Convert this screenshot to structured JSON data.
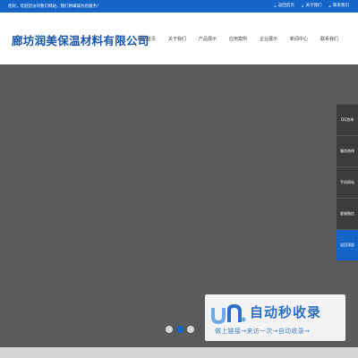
{
  "topbar": {
    "welcome": "您好，欢迎您访问我们网站，我们将竭诚为您服务！",
    "links": [
      {
        "icon": "home-icon",
        "glyph": "⌂",
        "label": "返回首页"
      },
      {
        "icon": "user-icon",
        "glyph": "⌂",
        "label": "关于我们"
      },
      {
        "icon": "phone-icon",
        "glyph": "⌂",
        "label": "联系我们"
      }
    ]
  },
  "header": {
    "company_name": "廊坊润美保温材料有限公司",
    "nav": [
      "网站首页",
      "关于我们",
      "产品展示",
      "应用案例",
      "企业展示",
      "新闻中心",
      "联系我们"
    ]
  },
  "carousel": {
    "dot_count": 3,
    "active_index": 1
  },
  "side_bar": {
    "items": [
      "QQ咨询",
      "服务热线",
      "手机网站",
      "客服微信",
      "返回顶部"
    ],
    "active_index": 4
  },
  "watermark": {
    "title": "自动秒收录",
    "subtitle": "做上链接→来访一次→自动收录→"
  },
  "colors": {
    "primary": "#1565c8",
    "banner": "#5b5b5b",
    "logo_text": "#1a56a8"
  }
}
